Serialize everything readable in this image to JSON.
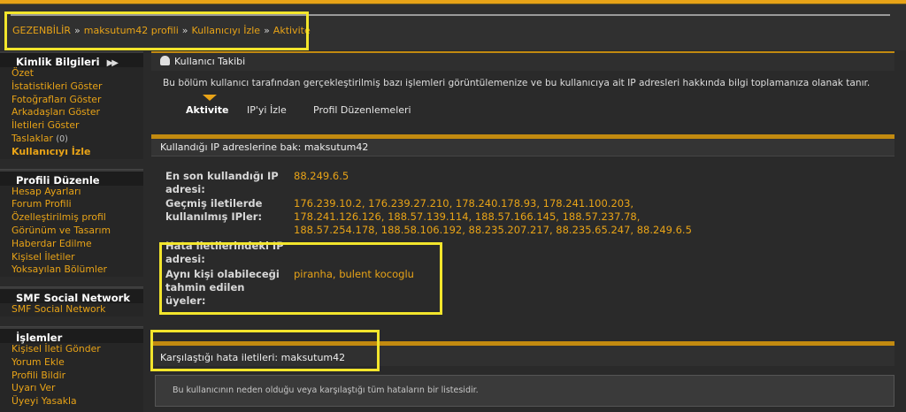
{
  "breadcrumb": {
    "items": [
      "GEZENBİLİR",
      "maksutum42 profili",
      "Kullanıcıyı İzle",
      "Aktivite"
    ],
    "separator": "»"
  },
  "sidebar": {
    "sections": [
      {
        "title": "Kimlik Bilgileri",
        "items": [
          "Özet",
          "İstatistikleri Göster",
          "Fotoğrafları Göster",
          "Arkadaşları Göster",
          "İletileri Göster",
          "Taslaklar",
          "Kullanıcıyı İzle"
        ],
        "drafts_count": "(0)",
        "active": "Kullanıcıyı İzle"
      },
      {
        "title": "Profili Düzenle",
        "items": [
          "Hesap Ayarları",
          "Forum Profili",
          "Özelleştirilmiş profil",
          "Görünüm ve Tasarım",
          "Haberdar Edilme",
          "Kişisel İletiler",
          "Yoksayılan Bölümler"
        ]
      },
      {
        "title": "SMF Social Network",
        "items": [
          "SMF Social Network"
        ]
      },
      {
        "title": "İşlemler",
        "items": [
          "Kişisel İleti Gönder",
          "Yorum Ekle",
          "Profili Bildir",
          "Uyarı Ver",
          "Üyeyi Yasakla"
        ]
      }
    ]
  },
  "main": {
    "panel_title": "Kullanıcı Takibi",
    "intro": "Bu bölüm kullanıcı tarafından gerçekleştirilmiş bazı işlemleri görüntülemenize ve bu kullanıcıya ait IP adresleri hakkında bilgi toplamanıza olanak tanır.",
    "tabs": [
      "Aktivite",
      "IP'yi İzle",
      "Profil Düzenlemeleri"
    ],
    "active_tab": "Aktivite",
    "ip_section_title": "Kullandığı IP adreslerine bak: maksutum42",
    "last_ip_label": [
      "En son kullandığı IP",
      "adresi:"
    ],
    "last_ip_value": "88.249.6.5",
    "past_ips_label": [
      "Geçmiş iletilerde",
      "kullanılmış IPler:"
    ],
    "past_ips_lines": [
      "176.239.10.2, 176.239.27.210, 178.240.178.93, 178.241.100.203,",
      "178.241.126.126, 188.57.139.114, 188.57.166.145, 188.57.237.78,",
      "188.57.254.178, 188.58.106.192, 88.235.207.217, 88.235.65.247, 88.249.6.5"
    ],
    "error_ip_label": [
      "Hata iletilerindeki IP",
      "adresi:"
    ],
    "same_person_label": [
      "Aynı kişi olabileceği",
      "tahmin edilen",
      "üyeler:"
    ],
    "same_person_value": "piranha, bulent kocoglu",
    "errors_title": "Karşılaştığı hata iletileri: maksutum42",
    "errors_description": "Bu kullanıcının neden olduğu veya karşılaştığı tüm hataların bir listesidir."
  },
  "colors": {
    "accent": "#e8a317",
    "highlight": "#f2e52c",
    "background": "#2a2a2a"
  }
}
